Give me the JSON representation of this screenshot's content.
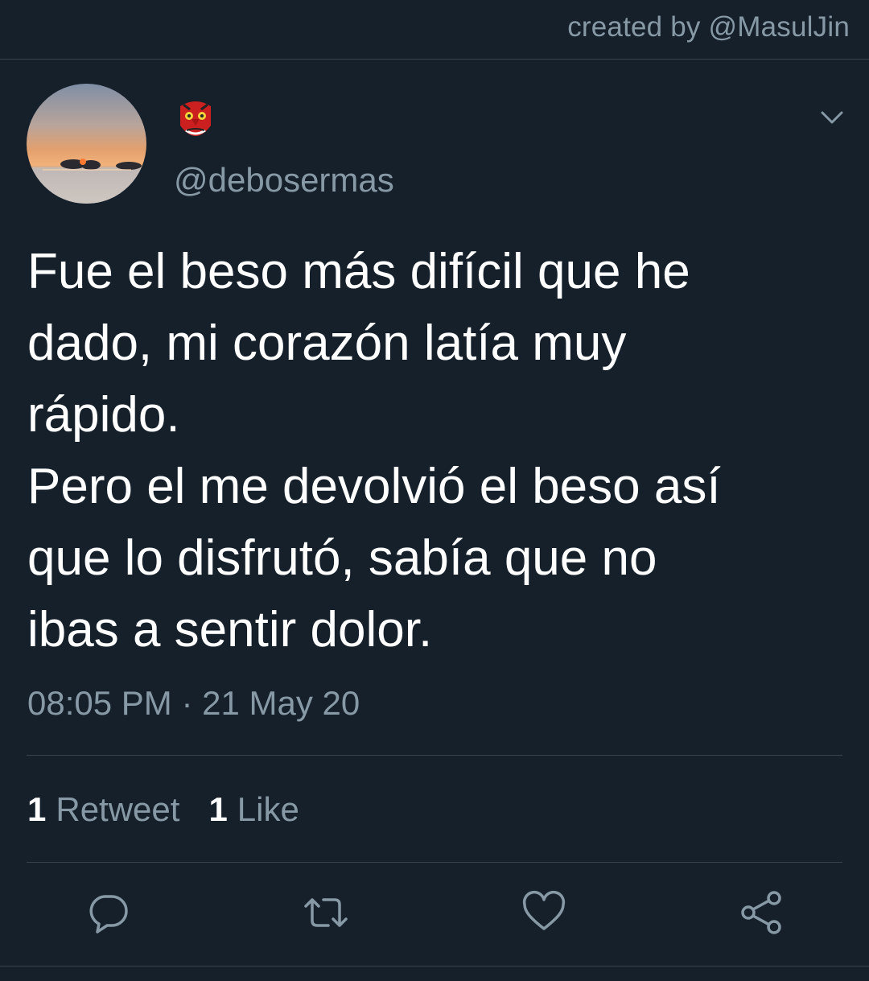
{
  "credit": "created by @MasulJin",
  "author": {
    "display_emoji": "tengu-mask-emoji",
    "handle": "@debosermas",
    "avatar": "sunset-over-sea-photo"
  },
  "tweet": {
    "lines": [
      "Fue el beso más difícil que he",
      "dado, mi corazón latía muy",
      "rápido.",
      "Pero el me devolvió el beso así",
      "que lo disfrutó, sabía que no",
      "ibas a sentir dolor."
    ],
    "time": "08:05 PM · 21 May 20"
  },
  "stats": {
    "retweets_count": "1",
    "retweets_label": "Retweet",
    "likes_count": "1",
    "likes_label": "Like"
  },
  "actions": [
    "reply-icon",
    "retweet-icon",
    "like-icon",
    "share-icon"
  ],
  "colors": {
    "background": "#15202b",
    "muted_text": "#8899a6",
    "divider": "#38444d"
  }
}
